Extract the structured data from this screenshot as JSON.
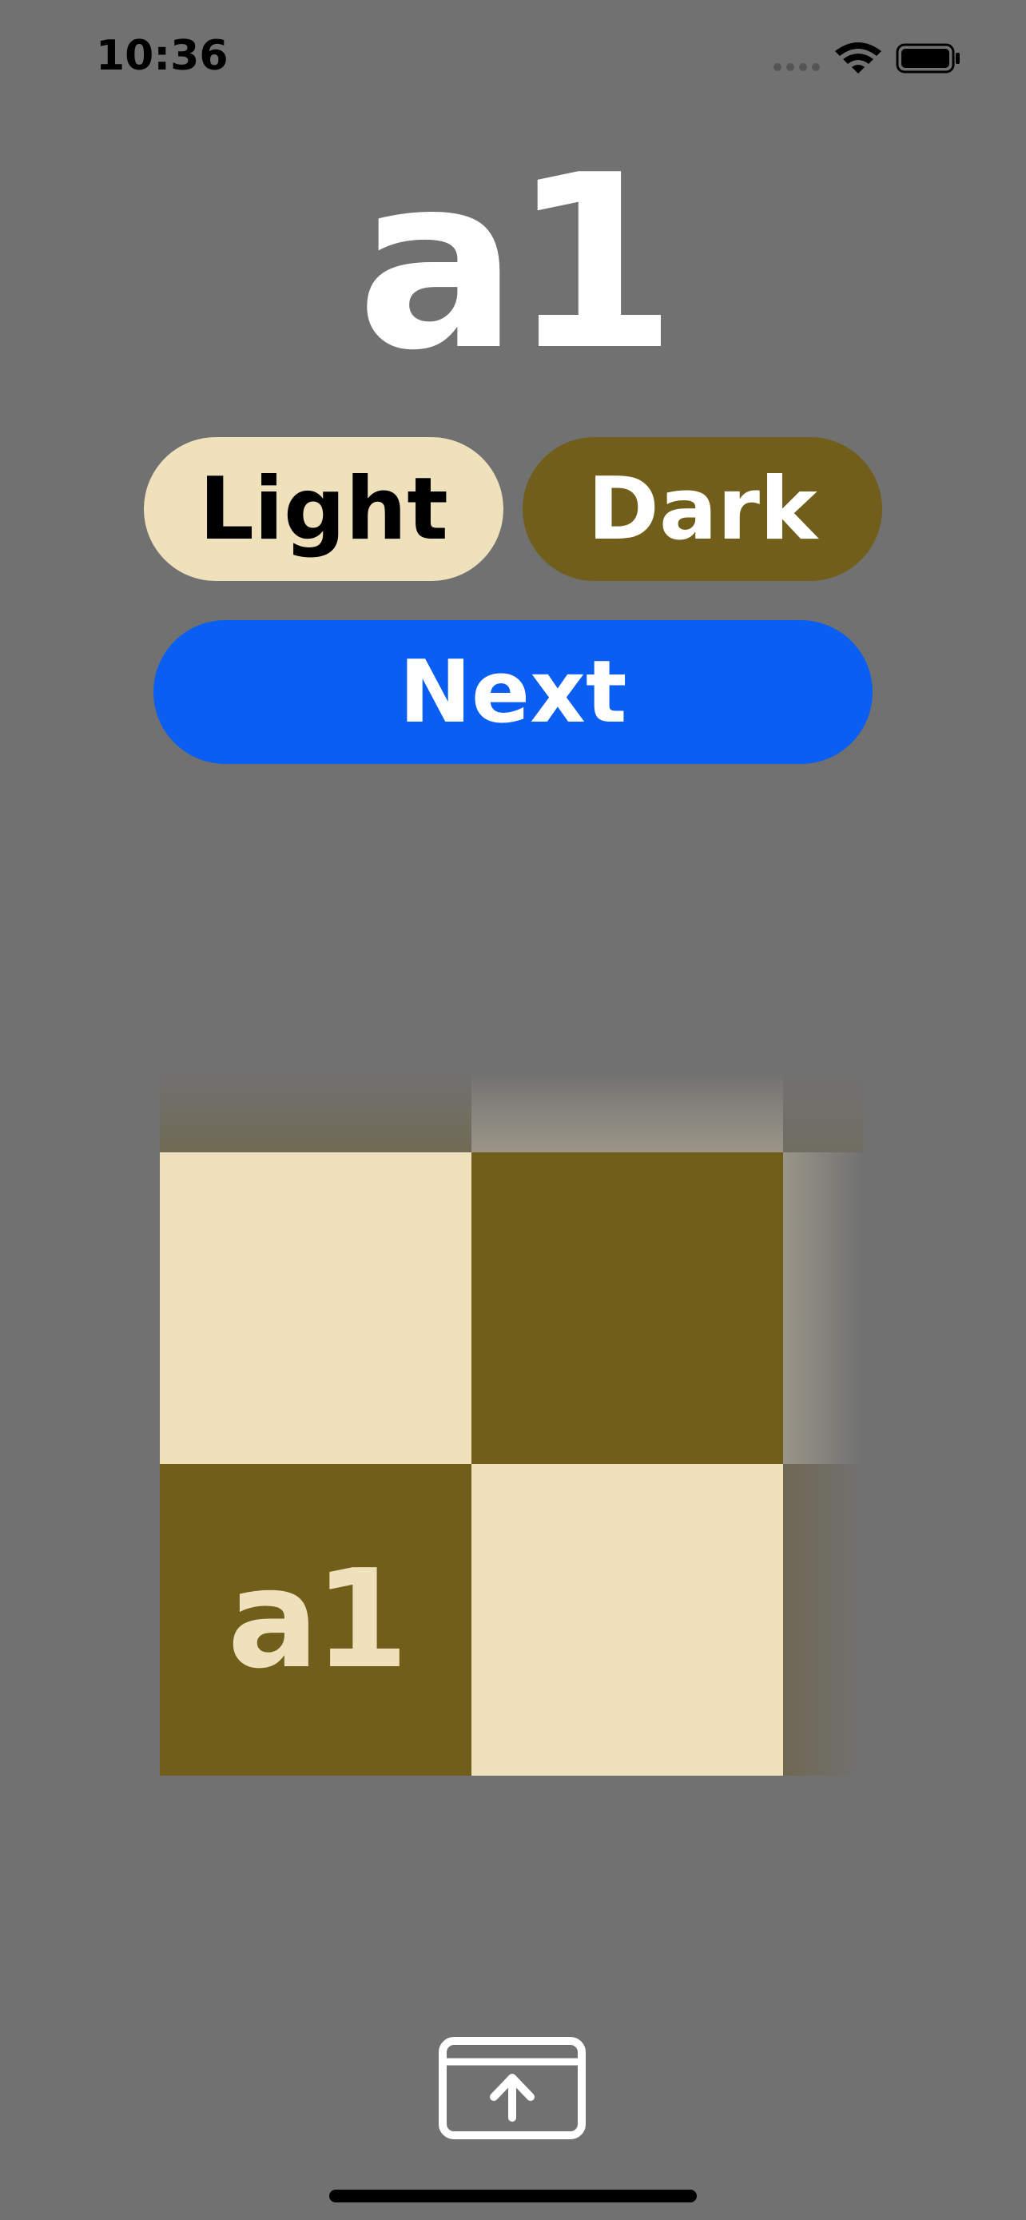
{
  "status_bar": {
    "time": "10:36"
  },
  "main": {
    "square_name": "a1"
  },
  "buttons": {
    "light_label": "Light",
    "dark_label": "Dark",
    "next_label": "Next"
  },
  "board": {
    "highlighted_square_label": "a1",
    "light_color": "#efe1bb",
    "dark_color": "#705e1a"
  },
  "colors": {
    "background": "#717171",
    "next_button": "#0a5ef2"
  },
  "icons": {
    "share": "share-upload-icon",
    "wifi": "wifi-icon",
    "battery": "battery-icon",
    "signal": "cellular-signal-icon"
  }
}
